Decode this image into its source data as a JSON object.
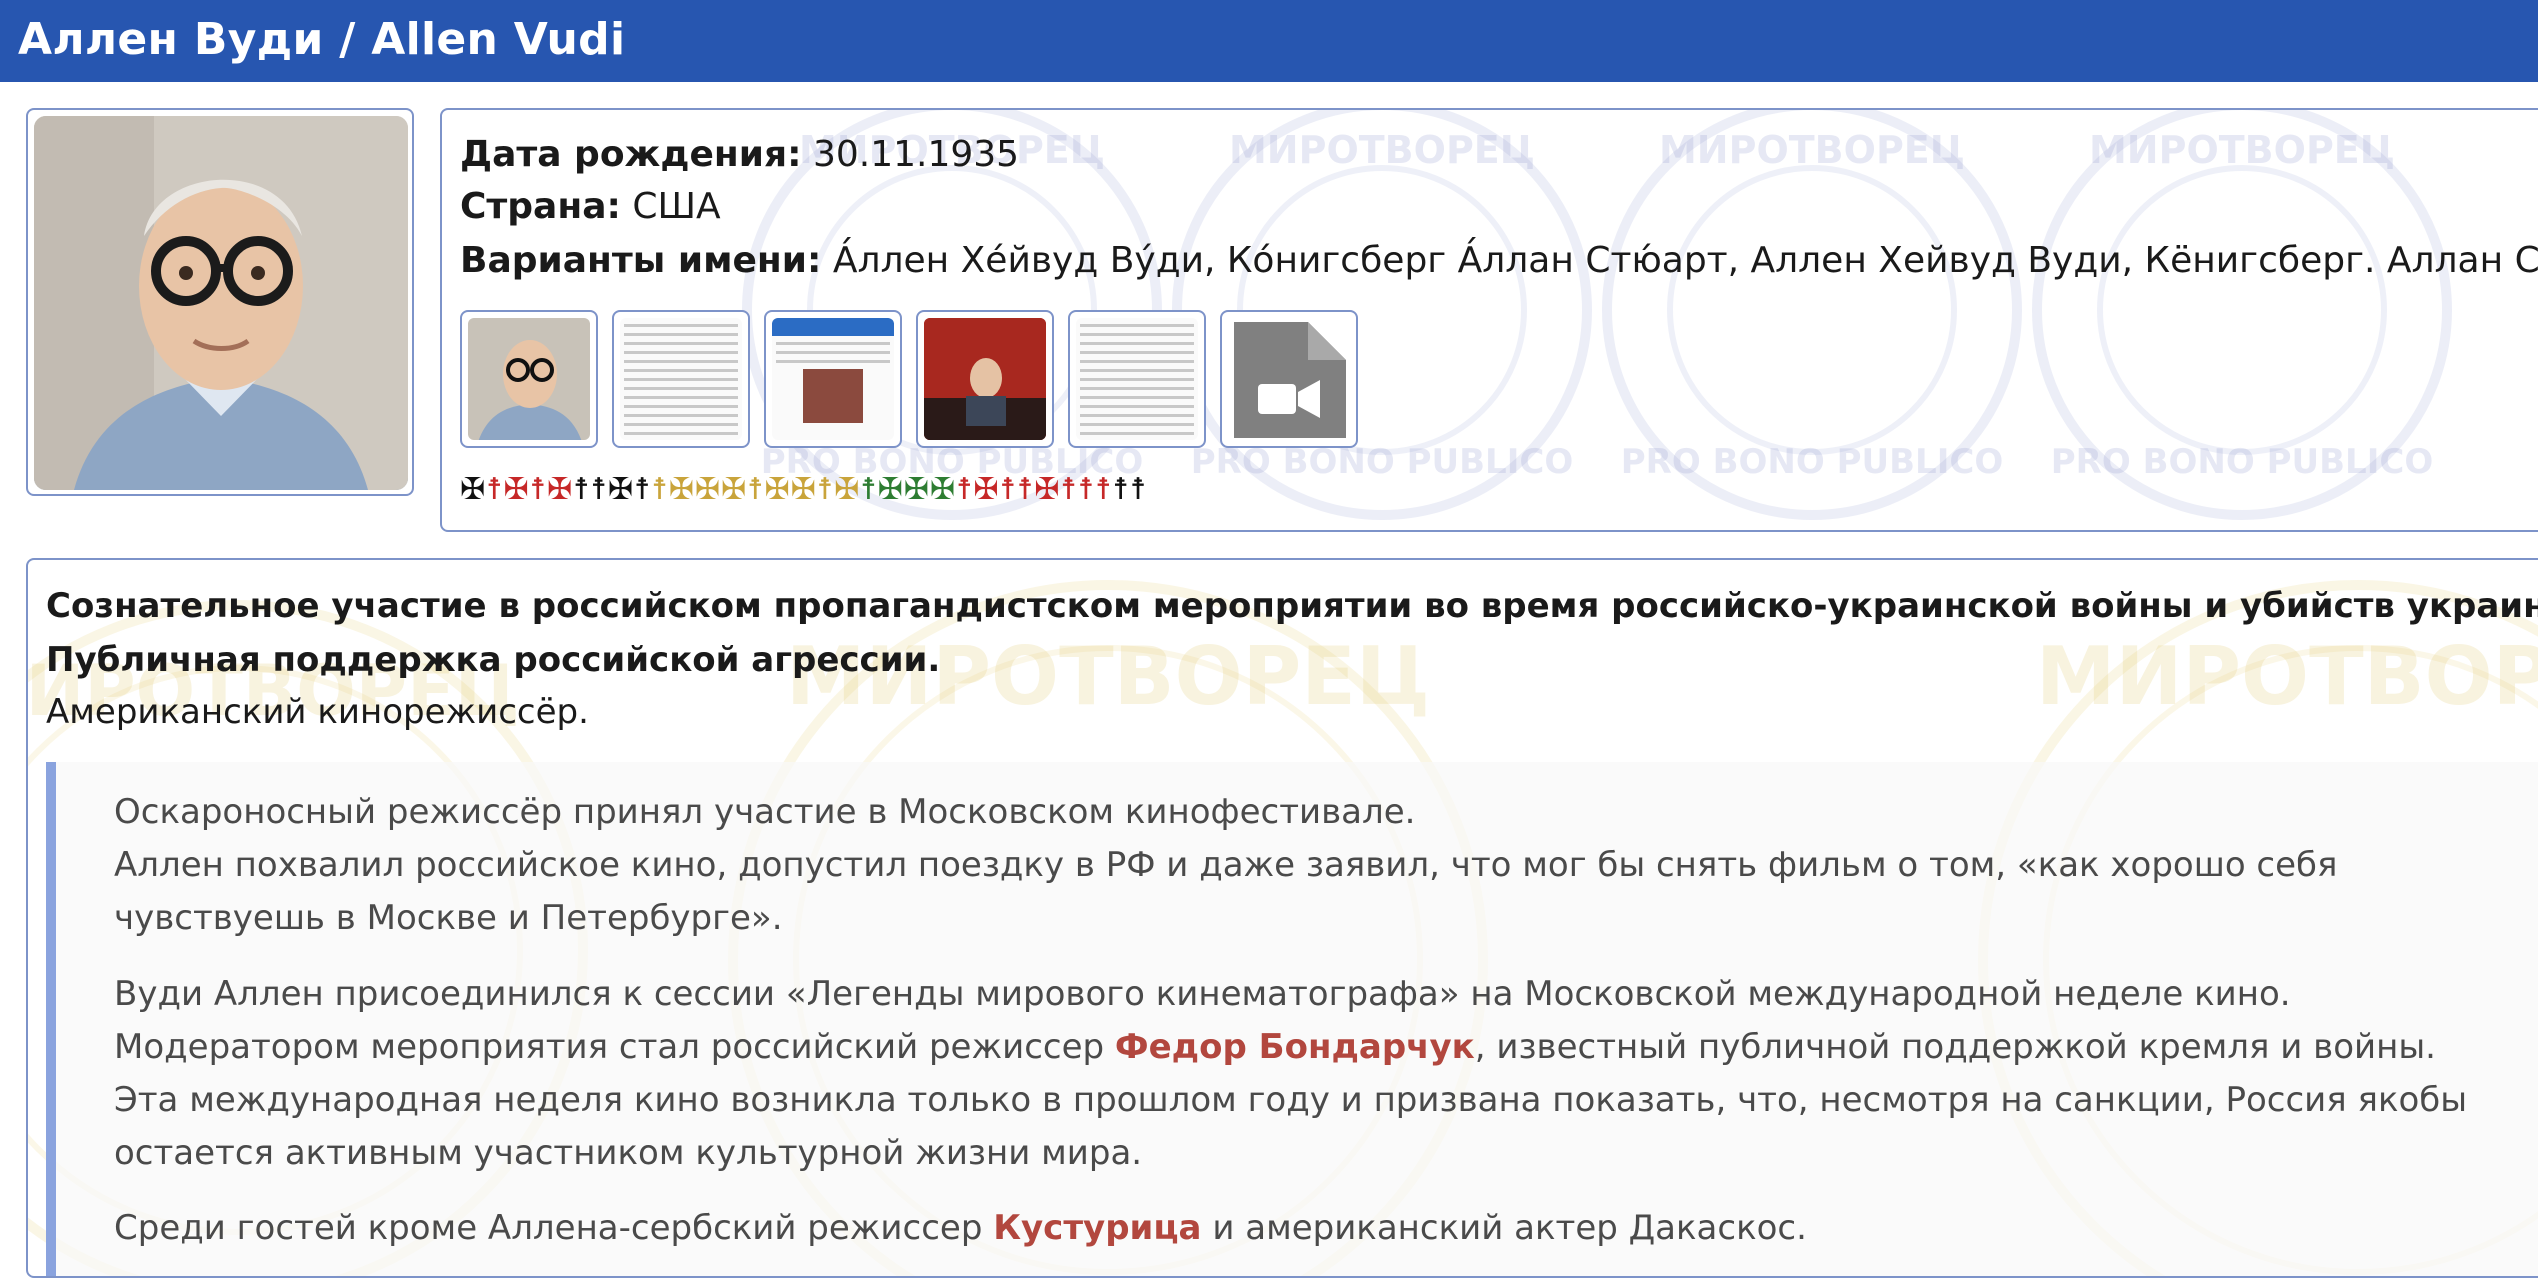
{
  "header": {
    "title": "Аллен Вуди / Allen Vudi"
  },
  "watermark": {
    "top": "МИРОТВОРЕЦ",
    "bottom": "PRO BONO PUBLICO"
  },
  "profile": {
    "birth_label": "Дата рождения:",
    "birth_value": "30.11.1935",
    "country_label": "Страна:",
    "country_value": "США",
    "names_label": "Варианты имени:",
    "names_value": "А́ллен Хе́йвуд Ву́ди, Ко́нигсберг А́ллан Стю́арт, Аллен Хейвуд Вуди, Кёнигсберг. Аллан Стюарт"
  },
  "thumbnails": [
    {
      "kind": "photo"
    },
    {
      "kind": "document"
    },
    {
      "kind": "document"
    },
    {
      "kind": "photo"
    },
    {
      "kind": "document"
    },
    {
      "kind": "video-icon"
    }
  ],
  "crosses": [
    {
      "glyph": "✠",
      "color": "black"
    },
    {
      "glyph": "☨",
      "color": "red"
    },
    {
      "glyph": "✠",
      "color": "red"
    },
    {
      "glyph": "☨",
      "color": "red"
    },
    {
      "glyph": "✠",
      "color": "red"
    },
    {
      "glyph": "☨",
      "color": "black"
    },
    {
      "glyph": "☨",
      "color": "black"
    },
    {
      "glyph": "✠",
      "color": "black"
    },
    {
      "glyph": "☨",
      "color": "black"
    },
    {
      "glyph": "☨",
      "color": "gold"
    },
    {
      "glyph": "✠",
      "color": "gold"
    },
    {
      "glyph": "✠",
      "color": "gold"
    },
    {
      "glyph": "✠",
      "color": "gold"
    },
    {
      "glyph": "☨",
      "color": "gold"
    },
    {
      "glyph": "✠",
      "color": "gold"
    },
    {
      "glyph": "✠",
      "color": "gold"
    },
    {
      "glyph": "☨",
      "color": "gold"
    },
    {
      "glyph": "✠",
      "color": "gold"
    },
    {
      "glyph": "☨",
      "color": "green"
    },
    {
      "glyph": "✠",
      "color": "green"
    },
    {
      "glyph": "✠",
      "color": "green"
    },
    {
      "glyph": "✠",
      "color": "green"
    },
    {
      "glyph": "☨",
      "color": "red"
    },
    {
      "glyph": "✠",
      "color": "red"
    },
    {
      "glyph": "☨",
      "color": "red"
    },
    {
      "glyph": "☨",
      "color": "red"
    },
    {
      "glyph": "✠",
      "color": "red"
    },
    {
      "glyph": "☨",
      "color": "red"
    },
    {
      "glyph": "☨",
      "color": "red"
    },
    {
      "glyph": "☨",
      "color": "red"
    },
    {
      "glyph": "☨",
      "color": "black"
    },
    {
      "glyph": "☨",
      "color": "black"
    }
  ],
  "colors": {
    "header_bg": "#2756b0",
    "link": "#b2473e",
    "quote_bar": "#8aa3de",
    "border": "#7d93c9"
  },
  "content": {
    "lead1": "Сознательное участие в российском пропагандистском мероприятии во время российско-украинской войны и убийств украинских граждан.",
    "lead2": "Публичная поддержка российской агрессии.",
    "subtitle": "Американский кинорежиссёр.",
    "p1_a": "Оскароносный режиссёр принял участие в Московском кинофестивале.",
    "p1_b": "Аллен похвалил российское кино, допустил поездку в РФ и даже заявил, что мог бы снять фильм о том, «как хорошо себя чувствуешь в Москве и Петербурге».",
    "p2_a": "Вуди Аллен присоединился к сессии «Легенды мирового кинематографа» на Московской международной неделе кино. Модератором мероприятия стал российский режиссер ",
    "p2_link": "Федор Бондарчук",
    "p2_b": ", известный публичной поддержкой кремля и войны.",
    "p2_c": "Эта международная неделя кино возникла только в прошлом году и призвана показать, что, несмотря на санкции, Россия якобы остается активным участником культурной жизни мира.",
    "p3_a": "Среди гостей кроме Аллена-сербский режиссер ",
    "p3_link": "Кустурица",
    "p3_b": " и американский актер Дакаскос."
  }
}
